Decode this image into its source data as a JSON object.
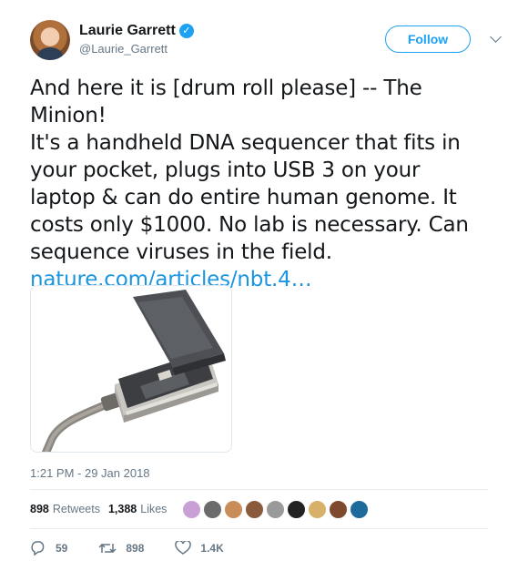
{
  "author": {
    "name": "Laurie Garrett",
    "handle": "@Laurie_Garrett",
    "verified_glyph": "✓"
  },
  "follow_label": "Follow",
  "tweet": {
    "text": "And here it is [drum roll please] -- The Minion!\nIt's a handheld DNA sequencer that fits in your pocket, plugs into USB 3 on your laptop & can do entire human genome. It costs only $1000. No lab is necessary. Can sequence viruses in the field.",
    "link": "nature.com/articles/nbt.4…"
  },
  "timestamp": "1:21 PM - 29 Jan 2018",
  "stats": {
    "retweets_count": "898",
    "retweets_label": "Retweets",
    "likes_count": "1,388",
    "likes_label": "Likes",
    "liker_avatar_colors": [
      "#c9a0d6",
      "#6b6b6b",
      "#c98d5a",
      "#8a5a3c",
      "#9a9a9a",
      "#222222",
      "#d8b06a",
      "#7d4a2e",
      "#1e6a9c"
    ]
  },
  "actions": {
    "reply_count": "59",
    "retweet_count": "898",
    "like_count": "1.4K"
  },
  "colors": {
    "accent": "#1da1f2",
    "link": "#1b95e0",
    "muted": "#657786"
  },
  "icons": [
    "verified-icon",
    "chevron-down-icon",
    "reply-icon",
    "retweet-icon",
    "like-icon"
  ]
}
